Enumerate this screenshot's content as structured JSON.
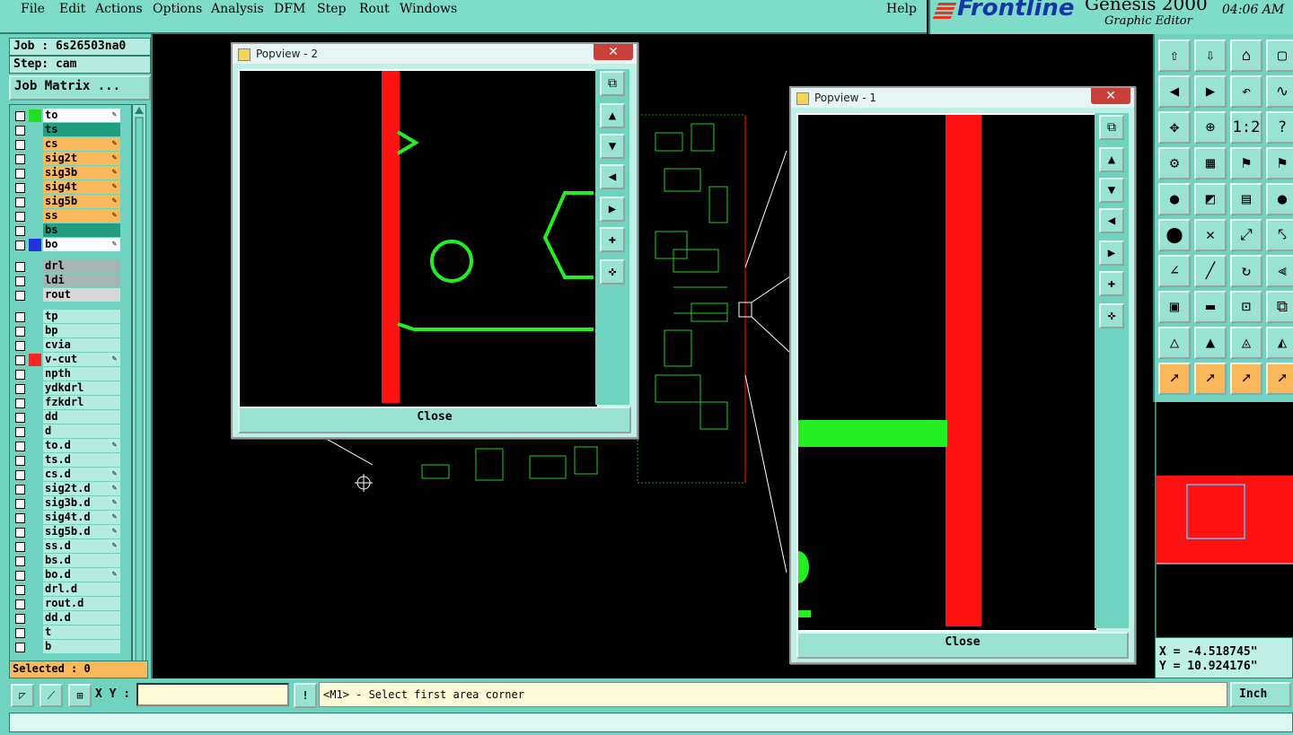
{
  "menu": {
    "items": [
      "File",
      "Edit",
      "Actions",
      "Options",
      "Analysis",
      "DFM",
      "Step",
      "Rout",
      "Windows"
    ],
    "help": "Help"
  },
  "brand": {
    "logo": "Frontline",
    "product": "Genesis 2000",
    "subtitle": "Graphic Editor",
    "clock": "04:06 AM"
  },
  "job": {
    "job_label": "Job : 6s26503na0",
    "step_label": "Step: cam",
    "matrix_button": "Job Matrix ..."
  },
  "layers": [
    {
      "name": "to",
      "bg": "#ffffff",
      "swatch": "#22dd22",
      "edit": true
    },
    {
      "name": "ts",
      "bg": "#1f9e82",
      "swatch": "",
      "edit": false
    },
    {
      "name": "cs",
      "bg": "#f9b85a",
      "swatch": "",
      "edit": true
    },
    {
      "name": "sig2t",
      "bg": "#f9b85a",
      "swatch": "",
      "edit": true
    },
    {
      "name": "sig3b",
      "bg": "#f9b85a",
      "swatch": "",
      "edit": true
    },
    {
      "name": "sig4t",
      "bg": "#f9b85a",
      "swatch": "",
      "edit": true
    },
    {
      "name": "sig5b",
      "bg": "#f9b85a",
      "swatch": "",
      "edit": true
    },
    {
      "name": "ss",
      "bg": "#f9b85a",
      "swatch": "",
      "edit": true
    },
    {
      "name": "bs",
      "bg": "#1f9e82",
      "swatch": "",
      "edit": false
    },
    {
      "name": "bo",
      "bg": "#ffffff",
      "swatch": "#2233dd",
      "edit": true
    },
    {
      "name": "drl",
      "bg": "#a8b4b4",
      "swatch": "",
      "edit": false
    },
    {
      "name": "ldi",
      "bg": "#a8b4b4",
      "swatch": "",
      "edit": false
    },
    {
      "name": "rout",
      "bg": "#d8d8d8",
      "swatch": "",
      "edit": false
    },
    {
      "name": "tp",
      "bg": "#b6ebdf",
      "swatch": "",
      "edit": false
    },
    {
      "name": "bp",
      "bg": "#b6ebdf",
      "swatch": "",
      "edit": false
    },
    {
      "name": "cvia",
      "bg": "#b6ebdf",
      "swatch": "",
      "edit": false
    },
    {
      "name": "v-cut",
      "bg": "#b6ebdf",
      "swatch": "#ff2222",
      "edit": true
    },
    {
      "name": "npth",
      "bg": "#b6ebdf",
      "swatch": "",
      "edit": false
    },
    {
      "name": "ydkdrl",
      "bg": "#b6ebdf",
      "swatch": "",
      "edit": false
    },
    {
      "name": "fzkdrl",
      "bg": "#b6ebdf",
      "swatch": "",
      "edit": false
    },
    {
      "name": "dd",
      "bg": "#b6ebdf",
      "swatch": "",
      "edit": false
    },
    {
      "name": "d",
      "bg": "#b6ebdf",
      "swatch": "",
      "edit": false
    },
    {
      "name": "to.d",
      "bg": "#b6ebdf",
      "swatch": "",
      "edit": true
    },
    {
      "name": "ts.d",
      "bg": "#b6ebdf",
      "swatch": "",
      "edit": false
    },
    {
      "name": "cs.d",
      "bg": "#b6ebdf",
      "swatch": "",
      "edit": true
    },
    {
      "name": "sig2t.d",
      "bg": "#b6ebdf",
      "swatch": "",
      "edit": true
    },
    {
      "name": "sig3b.d",
      "bg": "#b6ebdf",
      "swatch": "",
      "edit": true
    },
    {
      "name": "sig4t.d",
      "bg": "#b6ebdf",
      "swatch": "",
      "edit": true
    },
    {
      "name": "sig5b.d",
      "bg": "#b6ebdf",
      "swatch": "",
      "edit": true
    },
    {
      "name": "ss.d",
      "bg": "#b6ebdf",
      "swatch": "",
      "edit": true
    },
    {
      "name": "bs.d",
      "bg": "#b6ebdf",
      "swatch": "",
      "edit": false
    },
    {
      "name": "bo.d",
      "bg": "#b6ebdf",
      "swatch": "",
      "edit": true
    },
    {
      "name": "drl.d",
      "bg": "#b6ebdf",
      "swatch": "",
      "edit": false
    },
    {
      "name": "rout.d",
      "bg": "#b6ebdf",
      "swatch": "",
      "edit": false
    },
    {
      "name": "dd.d",
      "bg": "#b6ebdf",
      "swatch": "",
      "edit": false
    },
    {
      "name": "t",
      "bg": "#b6ebdf",
      "swatch": "",
      "edit": false
    },
    {
      "name": "b",
      "bg": "#b6ebdf",
      "swatch": "",
      "edit": false
    }
  ],
  "selected": "Selected : 0",
  "popview2": {
    "title": "Popview - 2",
    "close": "Close",
    "x": "✕"
  },
  "popview1": {
    "title": "Popview - 1",
    "close": "Close",
    "x": "✕"
  },
  "coords": {
    "x": "X = -4.518745\"",
    "y": "Y = 10.924176\""
  },
  "bottom": {
    "xy_label": "X Y :",
    "xy_value": "",
    "alert": "!",
    "message": "<M1> - Select first area corner",
    "unit": "Inch"
  },
  "colors": {
    "panel": "#6fd3bf",
    "highlight": "#f9b85a",
    "trace": "#22ee22",
    "vcut": "#ff1111"
  }
}
